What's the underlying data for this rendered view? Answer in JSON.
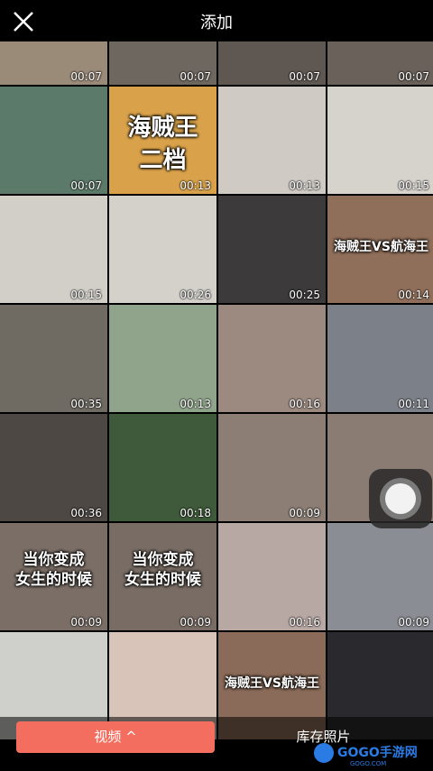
{
  "header": {
    "title": "添加"
  },
  "tiles": [
    {
      "duration": "00:07",
      "caption": "",
      "bg": "#9a8a78"
    },
    {
      "duration": "00:07",
      "caption": "",
      "bg": "#6e6760"
    },
    {
      "duration": "00:07",
      "caption": "",
      "bg": "#5f5852"
    },
    {
      "duration": "00:07",
      "caption": "",
      "bg": "#6a625a"
    },
    {
      "duration": "00:07",
      "caption": "",
      "bg": "#5c7a6a"
    },
    {
      "duration": "00:13",
      "caption": "海贼王\n二档",
      "bg": "#d9a24a"
    },
    {
      "duration": "00:13",
      "caption": "",
      "bg": "#cfcbc4"
    },
    {
      "duration": "00:15",
      "caption": "",
      "bg": "#d6d3cd"
    },
    {
      "duration": "00:15",
      "caption": "",
      "bg": "#d2cfc9"
    },
    {
      "duration": "00:26",
      "caption": "",
      "bg": "#d4d1cb"
    },
    {
      "duration": "00:25",
      "caption": "",
      "bg": "#3c3a3a"
    },
    {
      "duration": "00:14",
      "caption": "海贼王VS航海王",
      "bg": "#8f6e5a"
    },
    {
      "duration": "00:35",
      "caption": "",
      "bg": "#6f6a62"
    },
    {
      "duration": "00:13",
      "caption": "",
      "bg": "#8fa48a"
    },
    {
      "duration": "00:16",
      "caption": "",
      "bg": "#9c8a80"
    },
    {
      "duration": "00:11",
      "caption": "",
      "bg": "#7c8189"
    },
    {
      "duration": "00:36",
      "caption": "",
      "bg": "#4e4844"
    },
    {
      "duration": "00:18",
      "caption": "",
      "bg": "#3f5a3a"
    },
    {
      "duration": "00:09",
      "caption": "",
      "bg": "#8c7e74"
    },
    {
      "duration": "",
      "caption": "",
      "bg": "#8a7c72"
    },
    {
      "duration": "00:09",
      "caption": "当你变成\n女生的时候",
      "bg": "#7a6e66"
    },
    {
      "duration": "00:09",
      "caption": "当你变成\n女生的时候",
      "bg": "#786c64"
    },
    {
      "duration": "00:16",
      "caption": "",
      "bg": "#b8a8a4"
    },
    {
      "duration": "00:09",
      "caption": "",
      "bg": "#8a8e94"
    },
    {
      "duration": "",
      "caption": "",
      "bg": "#cfcfcb"
    },
    {
      "duration": "",
      "caption": "",
      "bg": "#d8c4b8"
    },
    {
      "duration": "",
      "caption": "海贼王VS航海王",
      "bg": "#8a6a58"
    },
    {
      "duration": "",
      "caption": "",
      "bg": "#2a2a2e"
    }
  ],
  "bottom": {
    "video_label": "视频 ^",
    "library_label": "库存照片"
  },
  "watermark": {
    "text": "GOGO手游网",
    "sub": "GOGO.COM"
  },
  "colors": {
    "accent": "#f36e5f"
  }
}
